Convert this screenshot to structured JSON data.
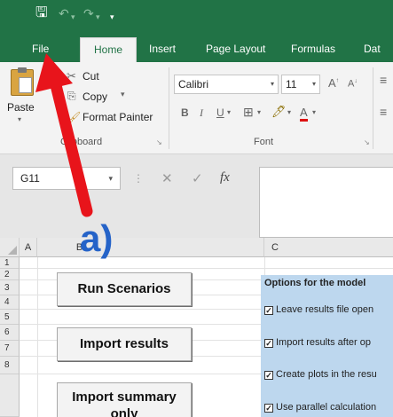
{
  "quick_access": {
    "save_icon": "save-icon",
    "undo_icon": "undo-icon",
    "redo_icon": "redo-icon",
    "customize_icon": "customize-qat-icon"
  },
  "tabs": [
    {
      "label": "File"
    },
    {
      "label": "Home"
    },
    {
      "label": "Insert"
    },
    {
      "label": "Page Layout"
    },
    {
      "label": "Formulas"
    },
    {
      "label": "Dat"
    }
  ],
  "ribbon": {
    "clipboard": {
      "paste": "Paste",
      "cut": "Cut",
      "copy": "Copy",
      "format_painter": "Format Painter",
      "group_label": "Clipboard"
    },
    "font": {
      "font_name": "Calibri",
      "font_size": "11",
      "bold": "B",
      "italic": "I",
      "underline": "U",
      "group_label": "Font"
    }
  },
  "formula_bar": {
    "name_box": "G11",
    "cancel": "✕",
    "enter": "✓",
    "fx": "fx",
    "value": ""
  },
  "columns": [
    "A",
    "B",
    "C"
  ],
  "rows": [
    "1",
    "2",
    "3",
    "4",
    "5",
    "6",
    "7",
    "8"
  ],
  "buttons": {
    "run_scenarios": "Run Scenarios",
    "import_results": "Import results",
    "import_summary_line1": "Import summary",
    "import_summary_line2": "only"
  },
  "options": {
    "title": "Options for the model",
    "items": [
      {
        "label": "Leave results file open",
        "checked": true
      },
      {
        "label": "Import results after op",
        "checked": true
      },
      {
        "label": "Create plots in the resu",
        "checked": true
      },
      {
        "label": "Use parallel calculation",
        "checked": true
      }
    ]
  },
  "annotation": {
    "label": "a)",
    "color": "#2563c8",
    "arrow_color": "#e8141b"
  },
  "colors": {
    "excel_green": "#217346",
    "panel_blue": "#bdd7ee"
  }
}
